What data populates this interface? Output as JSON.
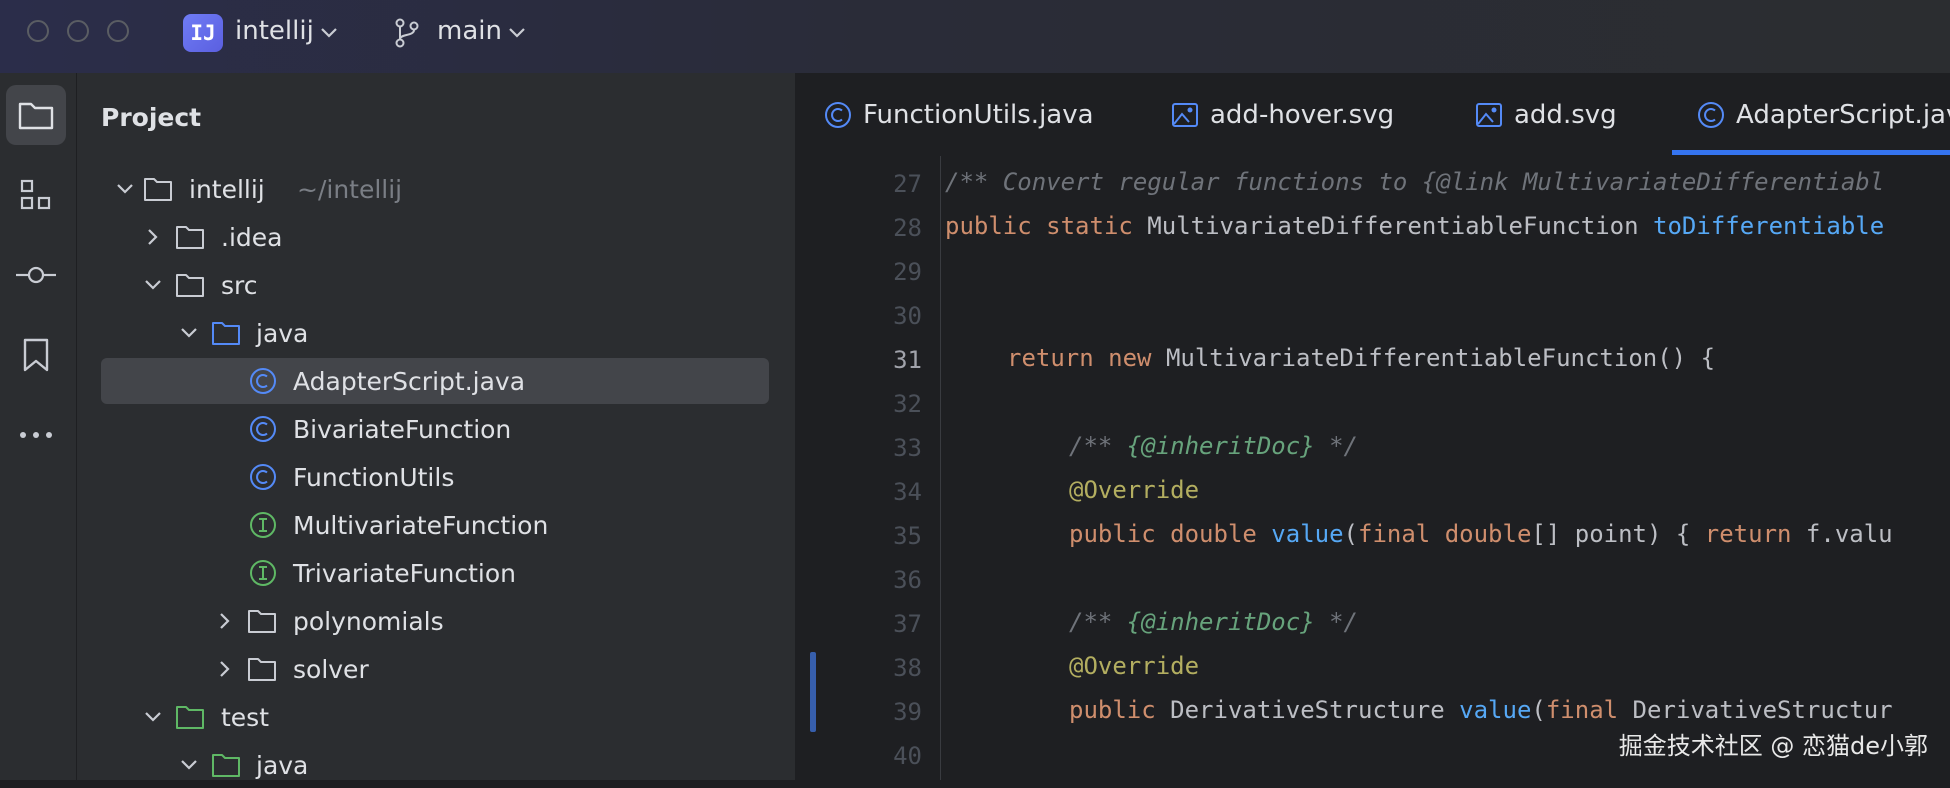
{
  "titlebar": {
    "project_badge": "IJ",
    "project_name": "intellij",
    "branch": "main"
  },
  "panel": {
    "title": "Project"
  },
  "tree": [
    {
      "label": "intellij",
      "hint": "~/intellij",
      "type": "folder",
      "expanded": true,
      "depth": 0
    },
    {
      "label": ".idea",
      "type": "folder",
      "expanded": false,
      "depth": 1
    },
    {
      "label": "src",
      "type": "folder",
      "expanded": true,
      "depth": 1
    },
    {
      "label": "java",
      "type": "source-folder",
      "expanded": true,
      "depth": 2
    },
    {
      "label": "AdapterScript.java",
      "type": "class",
      "depth": 3,
      "selected": true
    },
    {
      "label": "BivariateFunction",
      "type": "class",
      "depth": 3
    },
    {
      "label": "FunctionUtils",
      "type": "class",
      "depth": 3
    },
    {
      "label": "MultivariateFunction",
      "type": "interface",
      "depth": 3
    },
    {
      "label": "TrivariateFunction",
      "type": "interface",
      "depth": 3
    },
    {
      "label": "polynomials",
      "type": "folder",
      "expanded": false,
      "depth": 3
    },
    {
      "label": "solver",
      "type": "folder",
      "expanded": false,
      "depth": 3
    },
    {
      "label": "test",
      "type": "test-folder",
      "expanded": true,
      "depth": 1
    },
    {
      "label": "java",
      "type": "test-folder",
      "expanded": true,
      "depth": 2
    }
  ],
  "tabs": [
    {
      "label": "FunctionUtils.java",
      "icon": "class-icon"
    },
    {
      "label": "add-hover.svg",
      "icon": "image-icon"
    },
    {
      "label": "add.svg",
      "icon": "image-icon"
    },
    {
      "label": "AdapterScript.java",
      "icon": "class-icon",
      "active": true
    }
  ],
  "editor": {
    "line_numbers": [
      "27",
      "28",
      "29",
      "30",
      "31",
      "32",
      "33",
      "34",
      "35",
      "36",
      "37",
      "38",
      "39",
      "40"
    ],
    "current_line": "31"
  },
  "code_text": {
    "l27": "/** Convert regular functions to {@link MultivariateDifferentiabl",
    "l28_kw": "public static",
    "l28_type": " MultivariateDifferentiableFunction ",
    "l28_fn": "toDifferentiable",
    "l31_kw": "return new",
    "l31_rest": " MultivariateDifferentiableFunction() {",
    "l33_a": "/** ",
    "l33_tag": "{@inheritDoc}",
    "l33_b": " */",
    "l34": "@Override",
    "l35_kw1": "public double",
    "l35_fn": "value",
    "l35_p1": "(",
    "l35_kw2": "final double",
    "l35_p2": "[] point) { ",
    "l35_kw3": "return",
    "l35_p3": " f.valu",
    "l37_a": "/** ",
    "l37_tag": "{@inheritDoc}",
    "l37_b": " */",
    "l38": "@Override",
    "l39_kw1": "public",
    "l39_type": " DerivativeStructure ",
    "l39_fn": "value",
    "l39_p1": "(",
    "l39_kw2": "final",
    "l39_p2": " DerivativeStructur"
  },
  "watermark": "掘金技术社区 @ 恋猫de小郭",
  "colors": {
    "accent": "#3574f0",
    "keyword": "#cf8e6d",
    "function": "#56a8f5",
    "annotation": "#b3ae60",
    "comment": "#6f737a"
  }
}
